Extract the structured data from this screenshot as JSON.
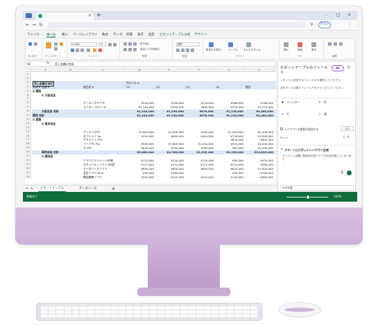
{
  "browser": {
    "tab_title": "",
    "profile_label": "テスト"
  },
  "ribbon_tabs": [
    {
      "label": "ファイル"
    },
    {
      "label": "ホーム"
    },
    {
      "label": "挿入"
    },
    {
      "label": "ページレイアウト"
    },
    {
      "label": "数式"
    },
    {
      "label": "データ"
    },
    {
      "label": "校閲"
    },
    {
      "label": "表示"
    },
    {
      "label": "固定"
    },
    {
      "label": "ピボットテーブル分析"
    },
    {
      "label": "デザイン"
    }
  ],
  "ribbon": {
    "font_name": "Calibri",
    "font_size": "11",
    "wrap_text": "折り返し",
    "merge_center": "結合して中央揃え",
    "number_format": "通貨",
    "groups": [
      "元に戻す",
      "クリップボード",
      "フォント",
      "配置",
      "数値",
      "スタイル",
      "セル",
      "編集"
    ],
    "cond_format": "条件付き書式",
    "table_format": "テーブル",
    "cell_styles": "セルのスタイル",
    "insert": "挿入",
    "delete": "削除",
    "format": "書式"
  },
  "formula": {
    "cell_ref": "A2",
    "value": "売上金額の合計"
  },
  "sheet": {
    "columns": [
      "A",
      "B",
      "C",
      "D",
      "E",
      "F",
      "G",
      "H",
      "I"
    ],
    "header_label": "売上金額の合計",
    "col_labels_label": "列ラベル",
    "row_labels": [
      "地域",
      "店舗",
      "商品名"
    ],
    "quarters": [
      "Q1",
      "Q2",
      "Q3",
      "Q4",
      "総計"
    ],
    "rows": [
      {
        "n": "5",
        "label": "関西",
        "indent": 0,
        "type": "group"
      },
      {
        "n": "6",
        "label": "大阪支店",
        "indent": 1,
        "type": "group"
      },
      {
        "n": "7",
        "label": "",
        "indent": 0,
        "type": "blank"
      },
      {
        "n": "8",
        "label": "ゲーミングマウス",
        "indent": 2,
        "type": "item",
        "v": [
          "¥544,000",
          "¥340,000",
          "¥216,000",
          "¥366,000",
          "¥766,000"
        ]
      },
      {
        "n": "9",
        "label": "モニター 32インチ",
        "indent": 2,
        "type": "item",
        "v": [
          "¥1,100,000",
          "¥990,000",
          "¥660,000",
          "¥330,000",
          "¥3,770,000"
        ]
      },
      {
        "n": "10",
        "label": "大阪支店 合計",
        "indent": 1,
        "type": "subtotal",
        "v": [
          "¥1,244,000",
          "¥1,230,000",
          "¥876,000",
          "¥1,134,000",
          "¥4,484,000"
        ]
      },
      {
        "n": "11",
        "label": "関西 合計",
        "indent": 0,
        "type": "subtotal",
        "v": [
          "¥1,244,000",
          "¥1,230,000",
          "¥876,000",
          "¥1,134,000",
          "¥4,484,000"
        ]
      },
      {
        "n": "12",
        "label": "関東",
        "indent": 0,
        "type": "group"
      },
      {
        "n": "13",
        "label": "東京本店",
        "indent": 1,
        "type": "group"
      },
      {
        "n": "14",
        "label": "",
        "indent": 0,
        "type": "blank"
      },
      {
        "n": "15",
        "label": "ゲーミングPC",
        "indent": 2,
        "type": "item",
        "v": [
          "¥1,800,000",
          "¥1,000,000",
          "¥200,000",
          "¥1,400,000",
          "¥5,400,000"
        ]
      },
      {
        "n": "16",
        "label": "タブレット Air",
        "indent": 2,
        "type": "item",
        "v": [
          "¥240,000",
          "¥649,000",
          "¥400,000",
          "¥720,000",
          "¥2,000,000"
        ]
      },
      {
        "n": "17",
        "label": "デスクトップPC",
        "indent": 2,
        "type": "item",
        "v": [
          "",
          "",
          "",
          "¥600,000",
          "¥600,000"
        ]
      },
      {
        "n": "18",
        "label": "ノートPC Pro",
        "indent": 2,
        "type": "item",
        "v": [
          "¥900,000",
          "¥1,809,000",
          "¥1,050,000",
          "¥450,000",
          "¥4,200,000"
        ]
      },
      {
        "n": "19",
        "label": "ミニPC",
        "indent": 2,
        "type": "item",
        "v": [
          "¥630,000",
          "¥535,000",
          "¥585,000",
          "¥65,000",
          "¥1,495,000"
        ]
      },
      {
        "n": "20",
        "label": "東京本店 合計",
        "indent": 1,
        "type": "subtotal",
        "v": [
          "¥3,660,000",
          "¥4,765,000",
          "¥2,235,000",
          "¥3,235,000",
          "¥13,895,000"
        ]
      },
      {
        "n": "21",
        "label": "横浜店",
        "indent": 1,
        "type": "group"
      },
      {
        "n": "22",
        "label": "クラウドストレージ年間",
        "indent": 2,
        "type": "item",
        "v": [
          "¥110,000",
          "¥120,000",
          "¥110,000",
          "¥90,000",
          "¥430,000"
        ]
      },
      {
        "n": "23",
        "label": "セキュリティソフト3年版",
        "indent": 2,
        "type": "item",
        "v": [
          "¥112,000",
          "¥112,000",
          "¥112,000",
          "¥224,000",
          "¥560,000"
        ]
      },
      {
        "n": "24",
        "label": "データベースソフト",
        "indent": 2,
        "type": "item",
        "v": [
          "¥650,000",
          "¥650,000",
          "¥650,000",
          "¥650,000",
          "¥2,600,000"
        ]
      },
      {
        "n": "25",
        "label": "会計ソフト2016",
        "indent": 2,
        "type": "item",
        "v": [
          "¥90,000",
          "¥180,000",
          "",
          "¥90,000",
          "¥360,000"
        ]
      },
      {
        "n": "26",
        "label": "動画編集ソフト",
        "indent": 2,
        "type": "item",
        "v": [
          "¥420,000",
          "¥210,000",
          "¥210,000",
          "¥140,000",
          "¥980,000"
        ]
      }
    ]
  },
  "sheet_tabs": [
    {
      "label": "ピボットテーブル"
    },
    {
      "label": "データソース"
    }
  ],
  "status": {
    "text": "準備完了",
    "zoom": "100%"
  },
  "pane": {
    "title": "ピボットテーブルのフィールド",
    "ai_label": "AI",
    "desc": "レポートに追加するフィールドを選択してください:",
    "desc2": "次のボックス間でフィールドをドラッグしてください:",
    "filter": "フィルター",
    "columns": "列",
    "rows": "行",
    "values": "値",
    "defer": "レイアウトの更新を保留する",
    "update": "更新",
    "view": "ビュー",
    "ai_card_title": "スマートにピボットレイアウト生成",
    "ai_card_text": "エリアごと店舗と製品別の売上データを四半期ごとにまとめて",
    "footer": "AI分析要"
  }
}
